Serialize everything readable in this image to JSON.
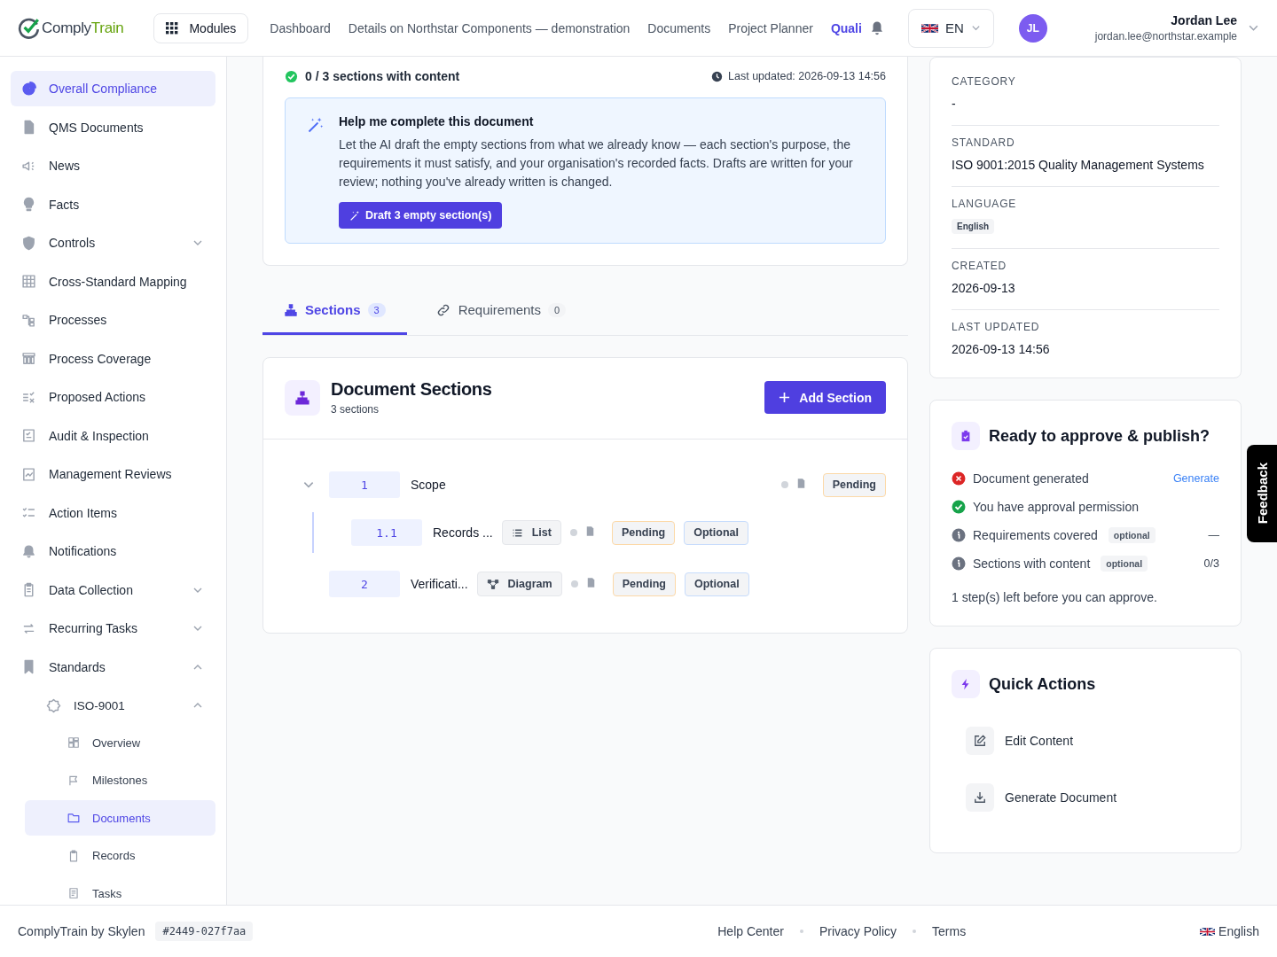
{
  "header": {
    "logo": {
      "first": "Comply",
      "second": "Train"
    },
    "modules_button": "Modules",
    "nav": [
      {
        "label": "Dashboard",
        "selected": false
      },
      {
        "label": "Details on Northstar Components — demonstration",
        "selected": false
      },
      {
        "label": "Documents",
        "selected": false
      },
      {
        "label": "Project Planner",
        "selected": false
      },
      {
        "label": "Quali",
        "selected": true
      }
    ],
    "language": "EN",
    "user": {
      "initials": "JL",
      "name": "Jordan Lee",
      "email": "jordan.lee@northstar.example"
    }
  },
  "sidebar": {
    "items": [
      {
        "label": "Overall Compliance",
        "selected": true
      },
      {
        "label": "QMS Documents",
        "selected": false
      },
      {
        "label": "News",
        "selected": false
      },
      {
        "label": "Facts",
        "selected": false
      },
      {
        "label": "Controls",
        "selected": false,
        "expanded": false
      },
      {
        "label": "Cross-Standard Mapping",
        "selected": false
      },
      {
        "label": "Processes",
        "selected": false
      },
      {
        "label": "Process Coverage",
        "selected": false
      },
      {
        "label": "Proposed Actions",
        "selected": false
      },
      {
        "label": "Audit & Inspection",
        "selected": false
      },
      {
        "label": "Management Reviews",
        "selected": false
      },
      {
        "label": "Action Items",
        "selected": false
      },
      {
        "label": "Notifications",
        "selected": false
      },
      {
        "label": "Data Collection",
        "selected": false,
        "expanded": false
      },
      {
        "label": "Recurring Tasks",
        "selected": false,
        "expanded": false
      },
      {
        "label": "Standards",
        "selected": false,
        "expanded": true,
        "children": [
          {
            "label": "ISO-9001",
            "selected": false,
            "expanded": true,
            "children": [
              {
                "label": "Overview",
                "selected": false
              },
              {
                "label": "Milestones",
                "selected": false
              },
              {
                "label": "Documents",
                "selected": true
              },
              {
                "label": "Records",
                "selected": false
              },
              {
                "label": "Tasks",
                "selected": false
              }
            ]
          }
        ]
      }
    ]
  },
  "progress": {
    "summary": "0 / 3 sections with content",
    "last_updated": "Last updated: 2026-09-13 14:56"
  },
  "ai_help": {
    "title": "Help me complete this document",
    "body": "Let the AI draft the empty sections from what we already know — each section's purpose, the requirements it must satisfy, and your organisation's recorded facts. Drafts are written for your review; nothing you've already written is changed.",
    "button": "Draft 3 empty section(s)"
  },
  "tabs": [
    {
      "label": "Sections",
      "count": "3",
      "selected": true
    },
    {
      "label": "Requirements",
      "count": "0",
      "selected": false
    }
  ],
  "sections_card": {
    "title": "Document Sections",
    "subtitle": "3 sections",
    "add_button": "Add Section",
    "rows": [
      {
        "number": "1",
        "title": "Scope",
        "has_content": false,
        "status": "Pending",
        "expanded": true,
        "children": [
          {
            "number": "1.1",
            "title": "Records ...",
            "format": {
              "kind": "list",
              "label": "List"
            },
            "has_content": false,
            "status": "Pending",
            "tag": "Optional"
          }
        ]
      },
      {
        "number": "2",
        "title": "Verificati...",
        "format": {
          "kind": "diagram",
          "label": "Diagram"
        },
        "has_content": false,
        "status": "Pending",
        "tag": "Optional"
      }
    ]
  },
  "details": [
    {
      "label": "CATEGORY",
      "value": "-",
      "kind": "text"
    },
    {
      "label": "STANDARD",
      "value": "ISO 9001:2015 Quality Management Systems",
      "kind": "text"
    },
    {
      "label": "LANGUAGE",
      "value": "English",
      "kind": "badge"
    },
    {
      "label": "CREATED",
      "value": "2026-09-13",
      "kind": "text"
    },
    {
      "label": "LAST UPDATED",
      "value": "2026-09-13 14:56",
      "kind": "text"
    }
  ],
  "approval": {
    "title": "Ready to approve & publish?",
    "checks": [
      {
        "kind": "fail",
        "label": "Document generated",
        "action": "Generate"
      },
      {
        "kind": "pass",
        "label": "You have approval permission"
      },
      {
        "kind": "info",
        "label": "Requirements covered",
        "badge": "optional",
        "value": "—"
      },
      {
        "kind": "info",
        "label": "Sections with content",
        "badge": "optional",
        "value": "0/3"
      }
    ],
    "note": "1 step(s) left before you can approve."
  },
  "quick_actions": {
    "title": "Quick Actions",
    "items": [
      {
        "kind": "edit",
        "label": "Edit Content"
      },
      {
        "kind": "download",
        "label": "Generate Document"
      }
    ]
  },
  "feedback_tab": "Feedback",
  "footer": {
    "brand": "ComplyTrain by Skylen",
    "build": "#2449-027f7aa",
    "links": [
      "Help Center",
      "Privacy Policy",
      "Terms"
    ],
    "language": "English"
  }
}
